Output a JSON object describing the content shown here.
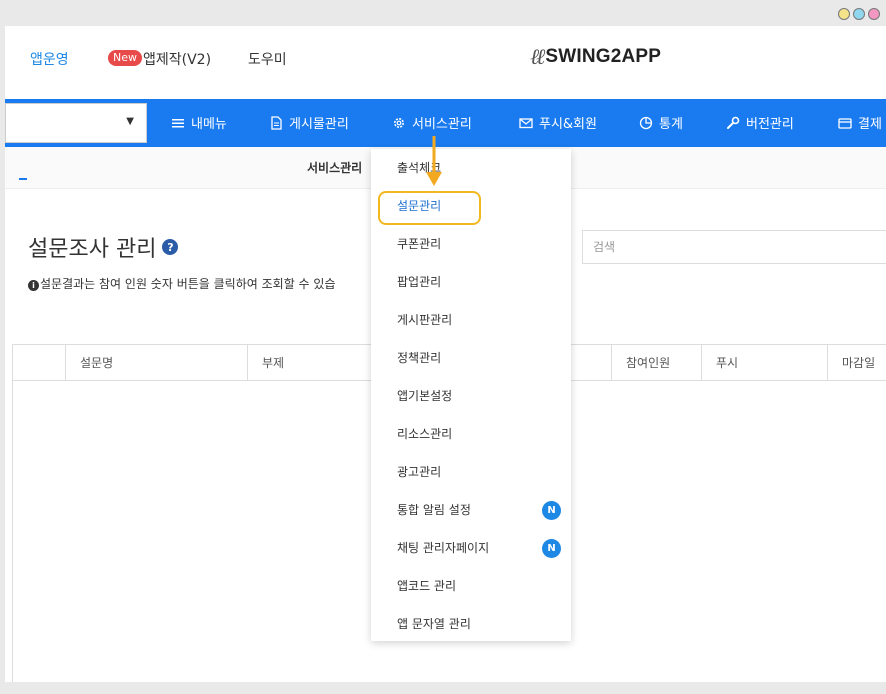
{
  "window": {
    "dot_colors": [
      "#f4e38a",
      "#8fd7ef",
      "#f296c2"
    ]
  },
  "topbar": {
    "links": {
      "app_operation": "앱운영",
      "new_badge": "New",
      "app_creation": "앱제작(V2)",
      "help": "도우미"
    },
    "logo_text": "SWING2APP"
  },
  "navbar": {
    "accent_color": "#1a7bf0",
    "app_select_value": "",
    "items": [
      {
        "label": "내메뉴",
        "icon": "hamburger-icon"
      },
      {
        "label": "게시물관리",
        "icon": "document-icon"
      },
      {
        "label": "서비스관리",
        "icon": "gear-icon"
      },
      {
        "label": "푸시&회원",
        "icon": "envelope-icon"
      },
      {
        "label": "통계",
        "icon": "pie-chart-icon"
      },
      {
        "label": "버전관리",
        "icon": "wrench-icon"
      },
      {
        "label": "결제",
        "icon": "card-icon"
      }
    ]
  },
  "breadcrumb": {
    "label": "서비스관리"
  },
  "main": {
    "title": "설문조사 관리",
    "info_text": "설문결과는 참여 인원 숫자 버튼을 클릭하여 조회할 수 있습",
    "search_placeholder": "검색",
    "table_headers": [
      "설문명",
      "부제",
      "참여인원",
      "푸시",
      "마감일"
    ]
  },
  "dropdown": {
    "items": [
      {
        "label": "출석체크",
        "badge": ""
      },
      {
        "label": "설문관리",
        "badge": "",
        "highlighted": true
      },
      {
        "label": "쿠폰관리",
        "badge": ""
      },
      {
        "label": "팝업관리",
        "badge": ""
      },
      {
        "label": "게시판관리",
        "badge": ""
      },
      {
        "label": "정책관리",
        "badge": ""
      },
      {
        "label": "앱기본설정",
        "badge": ""
      },
      {
        "label": "리소스관리",
        "badge": ""
      },
      {
        "label": "광고관리",
        "badge": ""
      },
      {
        "label": "통합 알림 설정",
        "badge": "N"
      },
      {
        "label": "채팅 관리자페이지",
        "badge": "N"
      },
      {
        "label": "앱코드 관리",
        "badge": ""
      },
      {
        "label": "앱 문자열 관리",
        "badge": ""
      }
    ],
    "highlight_color": "#f2b81f",
    "badge_color": "#1e88e5"
  }
}
